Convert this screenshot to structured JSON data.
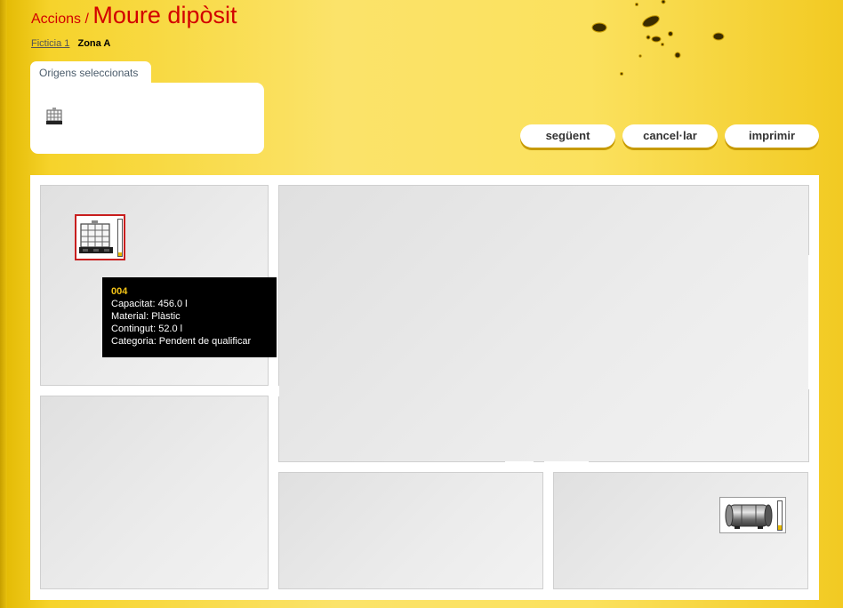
{
  "header": {
    "breadcrumb_root": "Accions",
    "separator": "/",
    "page_title": "Moure dipòsit"
  },
  "location": {
    "site_link": "Ficticia 1",
    "zone": "Zona A"
  },
  "origins_panel": {
    "tab_label": "Origens seleccionats",
    "items": [
      {
        "icon": "ibc-container-icon"
      }
    ]
  },
  "actions": {
    "next": "següent",
    "cancel": "cancel·lar",
    "print": "imprimir"
  },
  "floor_plan": {
    "tanks": [
      {
        "id": "004",
        "type": "ibc-container",
        "selected": true,
        "fill_level": 0.11
      },
      {
        "type": "cylindrical-tank",
        "selected": false,
        "fill_level": 0.15
      }
    ]
  },
  "tooltip": {
    "id": "004",
    "capacity": "Capacitat: 456.0 l",
    "material": "Material: Plàstic",
    "content": "Contingut: 52.0 l",
    "category": "Categoria: Pendent de qualificar"
  },
  "colors": {
    "title_red": "#d20000",
    "tank_fill": "#e6b800",
    "selection_border": "#c81e1e",
    "background_yellow": "#fbe15e"
  }
}
